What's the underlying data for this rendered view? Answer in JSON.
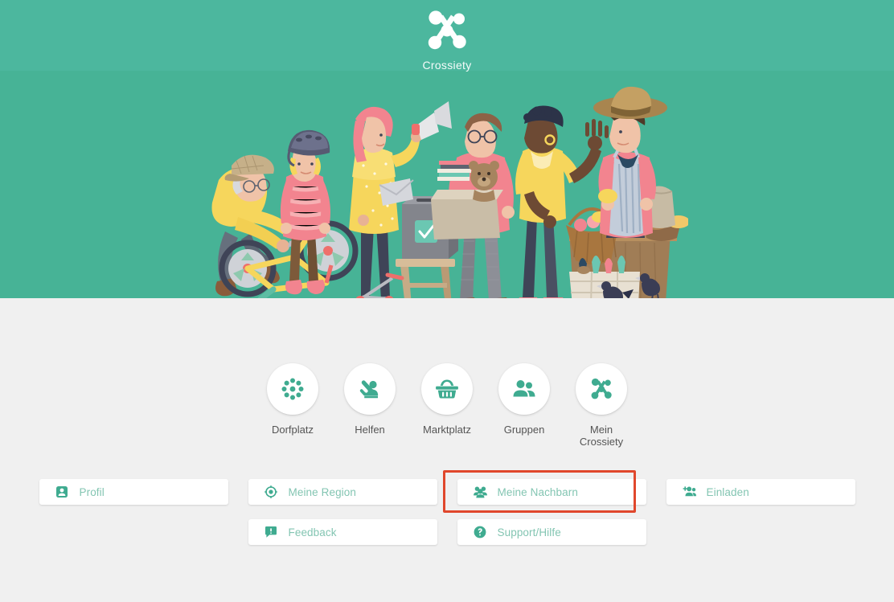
{
  "brand": {
    "name": "Crossiety",
    "logo_icon": "crossiety-x-logo-icon"
  },
  "colors": {
    "brand_green": "#47b396",
    "header_green": "#4cb79e",
    "page_background": "#f0f0f0",
    "card_background": "#ffffff",
    "icon_green": "#3fab90",
    "menu_label_green": "#83c5b2",
    "nav_label_gray": "#555555",
    "highlight_red": "#e0472c"
  },
  "hero": {
    "illustration_name": "community-people-illustration",
    "description": "Illustration of neighbours: man repairing a child's bike, child with helmet, woman with megaphone posting a letter into a ballot box, man carrying a box of books and a teddy bear, woman buying a lemon at a farmer's market stall, vendor with straw hat, pigeons"
  },
  "round_nav": {
    "items": [
      {
        "label": "Dorfplatz",
        "icon": "dots-circle-icon"
      },
      {
        "label": "Helfen",
        "icon": "person-raised-hand-icon"
      },
      {
        "label": "Marktplatz",
        "icon": "shopping-basket-icon"
      },
      {
        "label": "Gruppen",
        "icon": "two-people-icon"
      },
      {
        "label": "Mein\nCrossiety",
        "label_line1": "Mein",
        "label_line2": "Crossiety",
        "icon": "crossiety-x-logo-icon"
      }
    ]
  },
  "menu": {
    "row1": [
      {
        "label": "Profil",
        "icon": "id-badge-icon",
        "highlighted": false
      },
      {
        "label": "Meine Region",
        "icon": "location-target-icon",
        "highlighted": false
      },
      {
        "label": "Meine Nachbarn",
        "icon": "three-people-icon",
        "highlighted": true
      },
      {
        "label": "Einladen",
        "icon": "person-add-icon",
        "highlighted": false
      }
    ],
    "row2": [
      {
        "label": "Feedback",
        "icon": "speech-bubble-exclamation-icon",
        "highlighted": false
      },
      {
        "label": "Support/Hilfe",
        "icon": "question-circle-icon",
        "highlighted": false
      }
    ]
  }
}
